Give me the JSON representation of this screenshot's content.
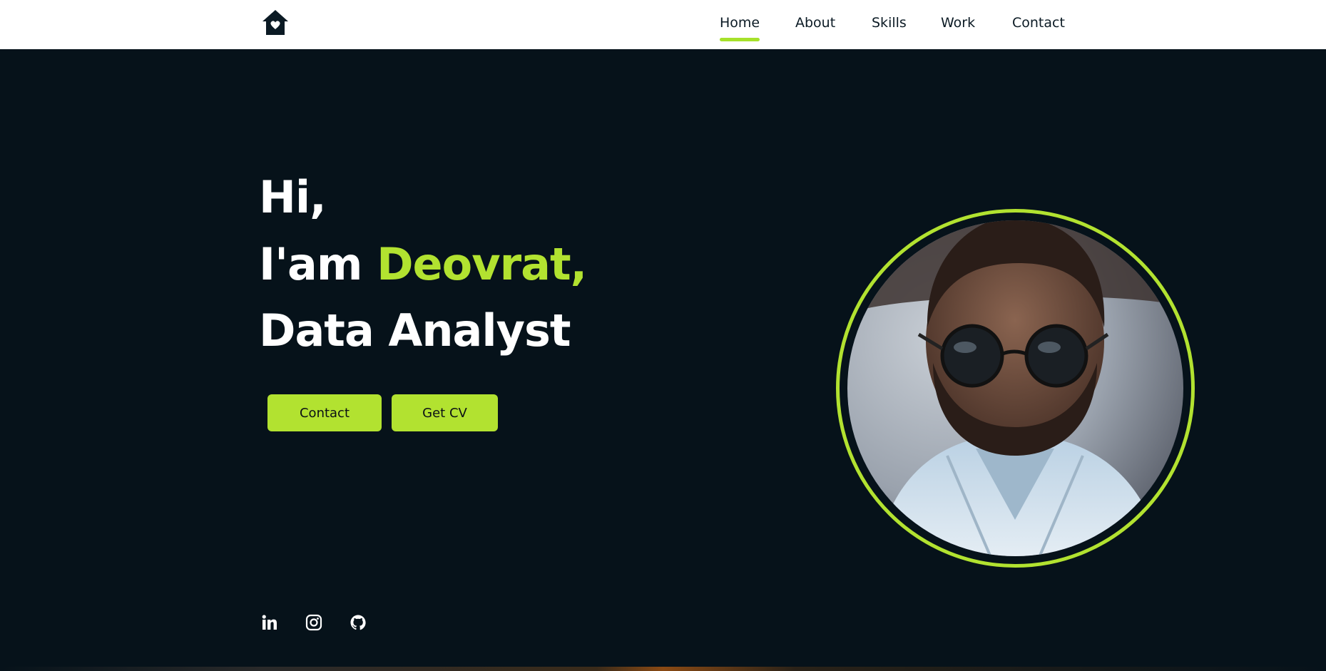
{
  "nav": {
    "items": [
      {
        "label": "Home",
        "active": true
      },
      {
        "label": "About",
        "active": false
      },
      {
        "label": "Skills",
        "active": false
      },
      {
        "label": "Work",
        "active": false
      },
      {
        "label": "Contact",
        "active": false
      }
    ]
  },
  "hero": {
    "greeting": "Hi,",
    "intro_prefix": "I'am ",
    "name": "Deovrat,",
    "role": "Data Analyst"
  },
  "buttons": {
    "contact_label": "Contact",
    "cv_label": "Get CV"
  },
  "social": {
    "icons": [
      "linkedin-icon",
      "instagram-icon",
      "github-icon"
    ]
  },
  "colors": {
    "accent": "#b2e230",
    "background": "#06121a",
    "header_bg": "#ffffff"
  }
}
